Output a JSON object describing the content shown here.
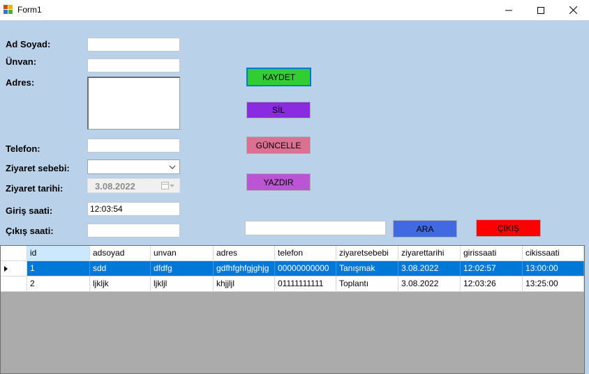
{
  "window": {
    "title": "Form1"
  },
  "form": {
    "labels": {
      "ad_soyad": "Ad Soyad:",
      "unvan": "Ünvan:",
      "adres": "Adres:",
      "telefon": "Telefon:",
      "ziyaret_sebebi": "Ziyaret sebebi:",
      "ziyaret_tarihi": "Ziyaret tarihi:",
      "giris_saati": "Giriş saati:",
      "cikis_saati": "Çıkış saati:"
    },
    "values": {
      "ad_soyad": "",
      "unvan": "",
      "adres": "",
      "telefon": "",
      "ziyaret_sebebi": "",
      "ziyaret_tarihi": "3.08.2022",
      "giris_saati": "12:03:54",
      "cikis_saati": "",
      "search": ""
    }
  },
  "buttons": {
    "kaydet": {
      "label": "KAYDET",
      "color": "#32cd32"
    },
    "sil": {
      "label": "SİL",
      "color": "#8a2be2"
    },
    "guncelle": {
      "label": "GÜNCELLE",
      "color": "#db7093"
    },
    "yazdir": {
      "label": "YAZDIR",
      "color": "#ba55d3"
    },
    "ara": {
      "label": "ARA",
      "color": "#4169e1"
    },
    "cikis": {
      "label": "ÇIKIŞ",
      "color": "#ff0000"
    }
  },
  "grid": {
    "columns": [
      "id",
      "adsoyad",
      "unvan",
      "adres",
      "telefon",
      "ziyaretsebebi",
      "ziyarettarihi",
      "girissaati",
      "cikissaati"
    ],
    "rows": [
      [
        "1",
        "sdd",
        "dfdfg",
        "gdfhfghfgjghjg",
        "00000000000",
        "Tanışmak",
        "3.08.2022",
        "12:02:57",
        "13:00:00"
      ],
      [
        "2",
        "ljkljk",
        "ljkljl",
        "khjjljl",
        "01111111111",
        "Toplantı",
        "3.08.2022",
        "12:03:26",
        "13:25:00"
      ]
    ],
    "selected_row": 0,
    "colors": {
      "selection": "#0078d7",
      "empty_area": "#ababab"
    }
  },
  "colors": {
    "form_background": "#bad1ea"
  },
  "icons": {
    "app": "app-icon",
    "minimize": "minimize-icon",
    "maximize": "maximize-icon",
    "close": "close-icon",
    "dropdown": "chevron-down-icon",
    "calendar": "calendar-icon",
    "row_indicator": "triangle-right-icon"
  }
}
